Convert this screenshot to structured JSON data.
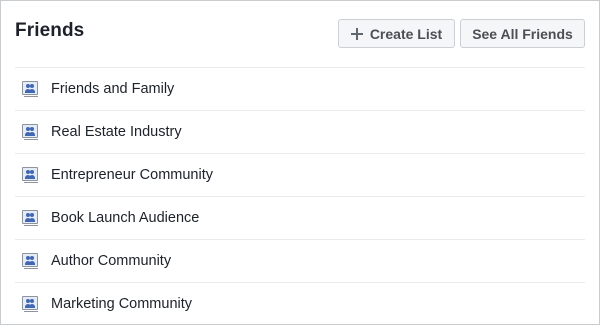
{
  "header": {
    "title": "Friends",
    "create_list_label": "Create List",
    "see_all_label": "See All Friends"
  },
  "lists": [
    {
      "label": "Friends and Family",
      "icon": "friend-list-icon"
    },
    {
      "label": "Real Estate Industry",
      "icon": "friend-list-icon"
    },
    {
      "label": "Entrepreneur Community",
      "icon": "friend-list-icon"
    },
    {
      "label": "Book Launch Audience",
      "icon": "friend-list-icon"
    },
    {
      "label": "Author Community",
      "icon": "friend-list-icon"
    },
    {
      "label": "Marketing Community",
      "icon": "friend-list-icon"
    }
  ],
  "colors": {
    "icon_blue": "#4267b2",
    "button_bg": "#f5f6f7",
    "divider": "#e9ebee"
  }
}
